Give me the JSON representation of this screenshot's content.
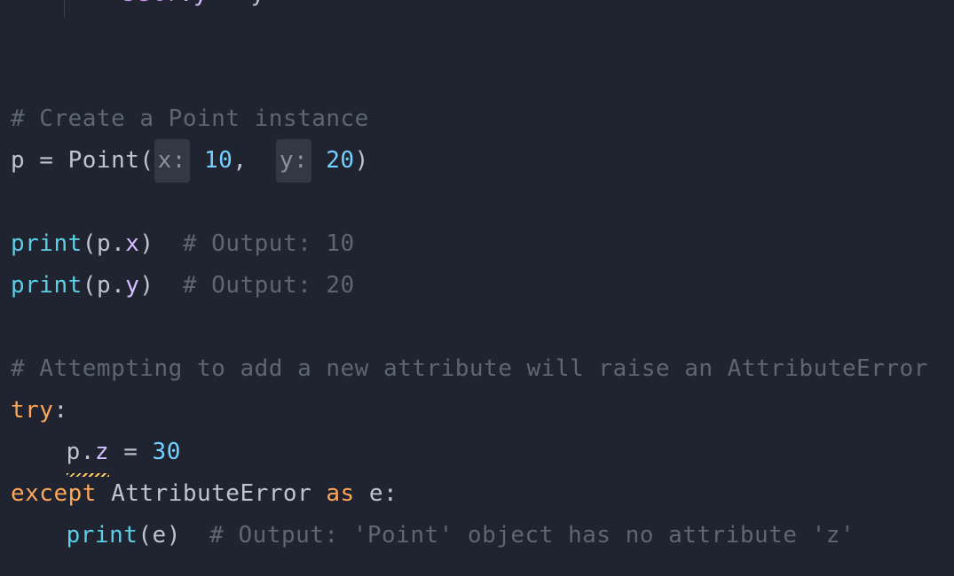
{
  "code": {
    "top_fragment": {
      "self": "self",
      "dot": ".",
      "attr": "y",
      "eq": " = ",
      "rhs": "y"
    },
    "comment_create": "# Create a Point instance",
    "assign_point": {
      "lhs": "p",
      "eq": " = ",
      "cls": "Point",
      "open": "(",
      "hint_x": "x:",
      "sp1": " ",
      "val_x": "10",
      "comma": ",  ",
      "hint_y": "y:",
      "sp2": " ",
      "val_y": "20",
      "close": ")"
    },
    "print1": {
      "fn": "print",
      "open": "(",
      "obj": "p",
      "dot": ".",
      "attr": "x",
      "close": ")",
      "gap": "  ",
      "comment": "# Output: 10"
    },
    "print2": {
      "fn": "print",
      "open": "(",
      "obj": "p",
      "dot": ".",
      "attr": "y",
      "close": ")",
      "gap": "  ",
      "comment": "# Output: 20"
    },
    "comment_attempt": "# Attempting to add a new attribute will raise an AttributeError",
    "try_kw": "try",
    "colon": ":",
    "assign_z": {
      "obj": "p",
      "dot": ".",
      "attr": "z",
      "eq": " = ",
      "val": "30"
    },
    "except_line": {
      "except": "except",
      "sp": " ",
      "exc": "AttributeError",
      "sp2": " ",
      "as": "as",
      "sp3": " ",
      "var": "e",
      "colon": ":"
    },
    "print_e": {
      "fn": "print",
      "open": "(",
      "arg": "e",
      "close": ")",
      "gap": "  ",
      "comment": "# Output: 'Point' object has no attribute 'z'"
    }
  }
}
